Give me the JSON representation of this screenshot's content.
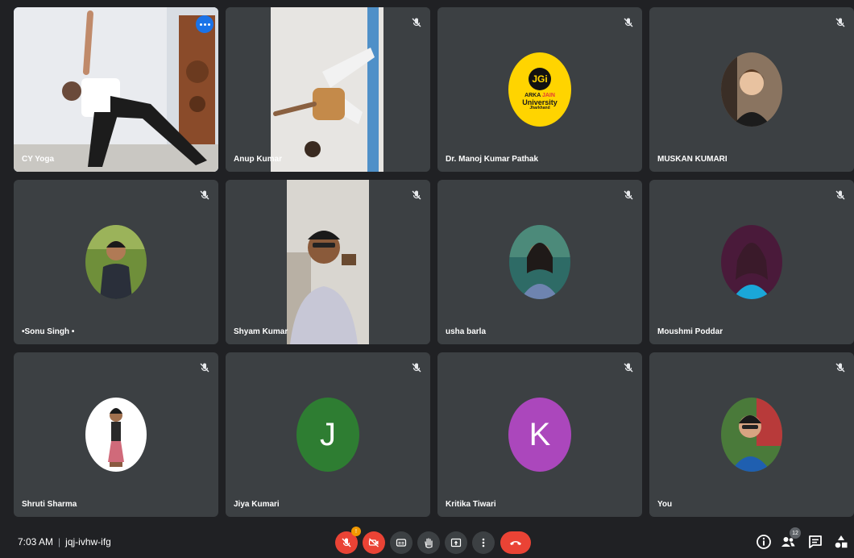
{
  "meeting": {
    "time": "7:03 AM",
    "code": "jqj-ivhw-ifg",
    "participant_count": "12",
    "mic_badge": "!"
  },
  "logo": {
    "monogram": "JGi",
    "line1a": "ARKA ",
    "line1b": "JAIN",
    "line2": "University",
    "line3": "Jharkhand"
  },
  "participants": [
    {
      "name": "CY Yoga",
      "kind": "video",
      "muted": false
    },
    {
      "name": "Anup Kumar",
      "kind": "video",
      "muted": true
    },
    {
      "name": "Dr. Manoj Kumar Pathak",
      "kind": "logo",
      "muted": true
    },
    {
      "name": "MUSKAN KUMARI",
      "kind": "photo",
      "muted": true
    },
    {
      "name": "•Sonu Singh •",
      "kind": "photo",
      "muted": true
    },
    {
      "name": "Shyam Kumar",
      "kind": "video",
      "muted": true
    },
    {
      "name": "usha barla",
      "kind": "photo",
      "muted": true
    },
    {
      "name": "Moushmi Poddar",
      "kind": "photo",
      "muted": true
    },
    {
      "name": "Shruti Sharma",
      "kind": "photo",
      "muted": true
    },
    {
      "name": "Jiya Kumari",
      "kind": "letter",
      "letter": "J",
      "color": "#2e7d32",
      "muted": true
    },
    {
      "name": "Kritika Tiwari",
      "kind": "letter",
      "letter": "K",
      "color": "#ab47bc",
      "muted": true
    },
    {
      "name": "You",
      "kind": "photo",
      "muted": true
    }
  ],
  "colors": {
    "background": "#202124",
    "tile": "#3c4043",
    "active_outline": "#8ab4f8",
    "more_button": "#1a73e8",
    "hangup": "#ea4335",
    "camera_off": "#ea4335",
    "mic_off": "#ea4335",
    "badge": "#f29900"
  },
  "icons": {
    "tile_muted": "mic-off-icon",
    "tile_options": "more-options-icon",
    "controls": [
      "mic-off-icon",
      "camera-off-icon",
      "captions-icon",
      "raise-hand-icon",
      "present-icon",
      "more-options-icon",
      "hang-up-icon"
    ],
    "right_controls": [
      "info-icon",
      "people-icon",
      "chat-icon",
      "activities-icon"
    ]
  }
}
